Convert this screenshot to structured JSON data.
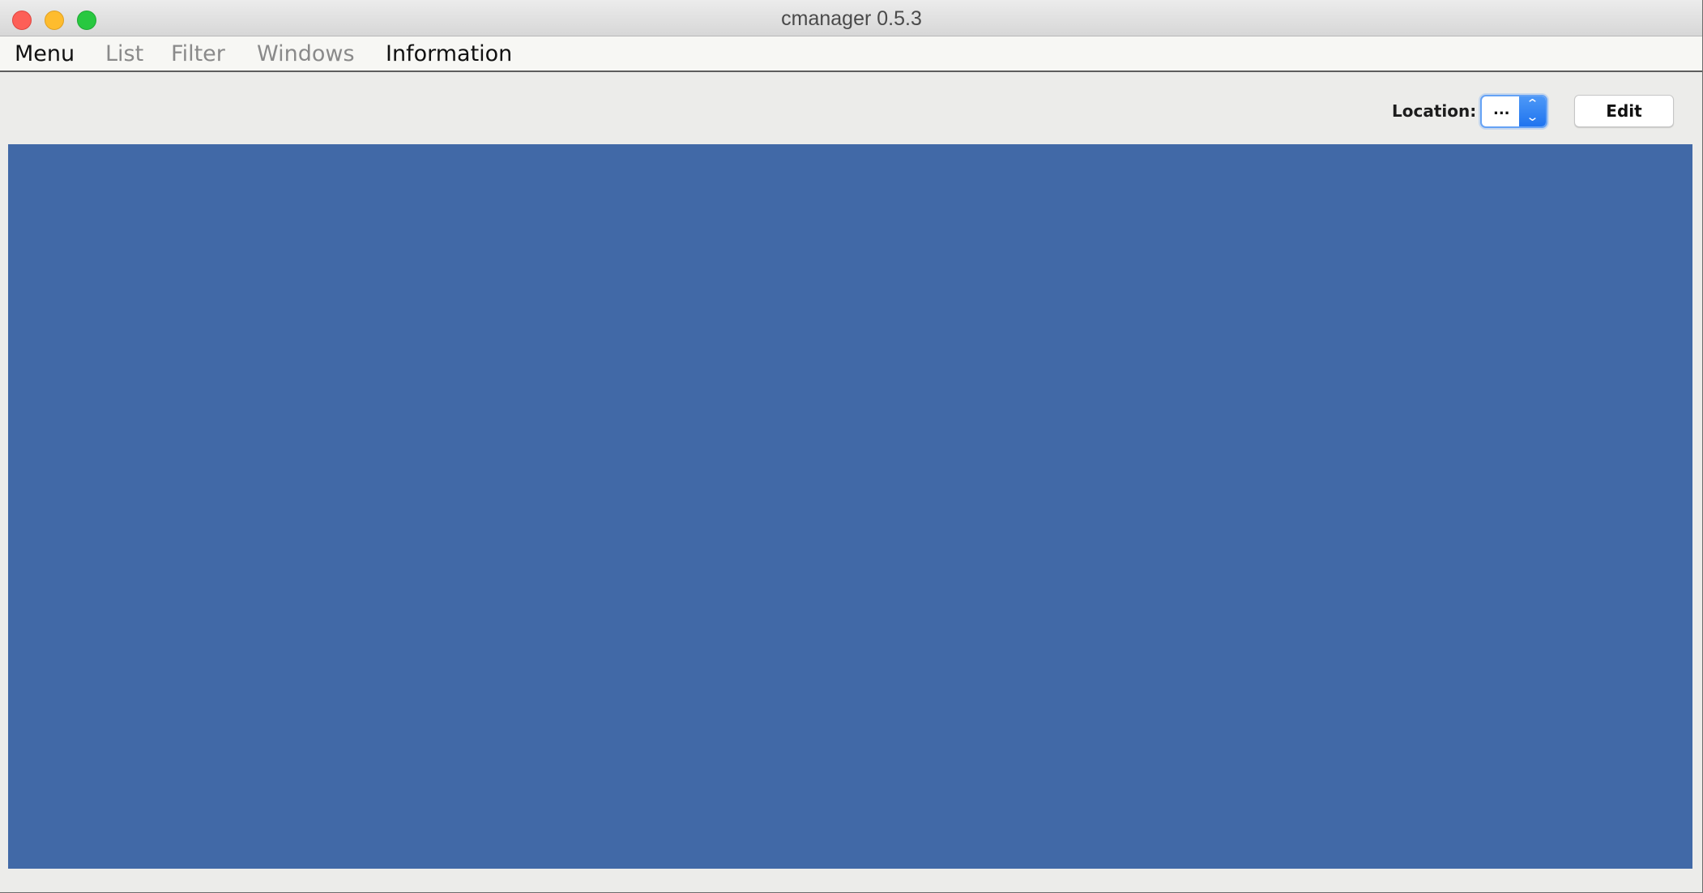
{
  "window": {
    "title": "cmanager 0.5.3"
  },
  "menu": {
    "items": [
      {
        "label": "Menu",
        "enabled": true
      },
      {
        "label": "List",
        "enabled": false
      },
      {
        "label": "Filter",
        "enabled": false
      },
      {
        "label": "Windows",
        "enabled": false
      },
      {
        "label": "Information",
        "enabled": true
      }
    ]
  },
  "toolbar": {
    "location_label": "Location:",
    "location_value": "...",
    "edit_label": "Edit"
  },
  "colors": {
    "content_panel": "#4169a7",
    "accent": "#1f74ef",
    "close": "#fd5f57",
    "minimize": "#febc2e",
    "maximize": "#28c840"
  },
  "icons": {
    "close": "close-icon",
    "minimize": "minimize-icon",
    "maximize": "maximize-icon",
    "select_arrows": "chevron-up-down-icon"
  }
}
